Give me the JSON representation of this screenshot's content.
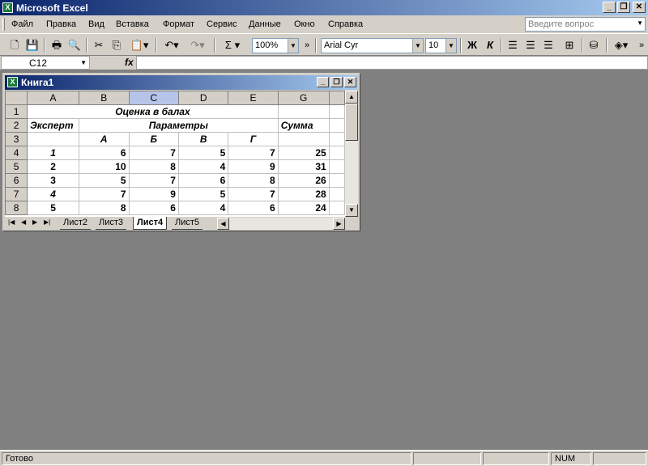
{
  "app": {
    "title": "Microsoft Excel",
    "icon_label": "X"
  },
  "window_controls": {
    "minimize": "_",
    "restore": "❐",
    "close": "✕"
  },
  "menu": [
    "Файл",
    "Правка",
    "Вид",
    "Вставка",
    "Формат",
    "Сервис",
    "Данные",
    "Окно",
    "Справка"
  ],
  "ask": {
    "placeholder": "Введите вопрос"
  },
  "toolbar": {
    "zoom": "100%",
    "font": "Arial Cyr",
    "size": "10",
    "bold": "Ж",
    "italic": "К",
    "sigma": "Σ",
    "more": "»"
  },
  "formula_bar": {
    "cell_ref": "C12",
    "fx": "fx",
    "value": ""
  },
  "workbook": {
    "title": "Книга1",
    "columns": [
      "A",
      "B",
      "C",
      "D",
      "E",
      "G"
    ],
    "selected_column": "C",
    "rows": [
      {
        "num": "1",
        "cells": {
          "merged": "Оценка в балах"
        }
      },
      {
        "num": "2",
        "cells": [
          "Эксперт",
          "Параметры",
          "Сумма"
        ]
      },
      {
        "num": "3",
        "cells": [
          "",
          "А",
          "Б",
          "В",
          "Г",
          ""
        ]
      },
      {
        "num": "4",
        "cells": [
          "1",
          "6",
          "7",
          "5",
          "7",
          "25"
        ]
      },
      {
        "num": "5",
        "cells": [
          "2",
          "10",
          "8",
          "4",
          "9",
          "31"
        ]
      },
      {
        "num": "6",
        "cells": [
          "3",
          "5",
          "7",
          "6",
          "8",
          "26"
        ]
      },
      {
        "num": "7",
        "cells": [
          "4",
          "7",
          "9",
          "5",
          "7",
          "28"
        ]
      },
      {
        "num": "8",
        "cells": [
          "5",
          "8",
          "6",
          "4",
          "6",
          "24"
        ]
      }
    ],
    "sheets": [
      "Лист2",
      "Лист3",
      "Лист4",
      "Лист5"
    ],
    "active_sheet": "Лист4"
  },
  "status": {
    "ready": "Готово",
    "num": "NUM"
  }
}
